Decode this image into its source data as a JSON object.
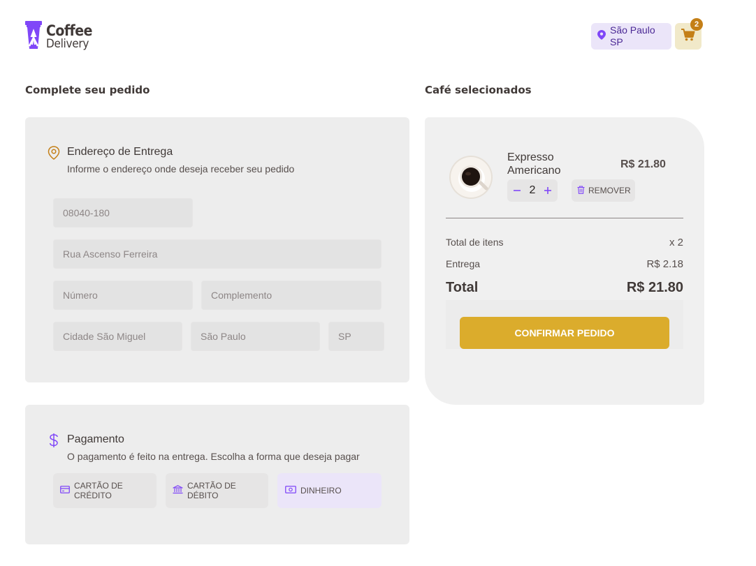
{
  "header": {
    "logo_line1": "Coffee",
    "logo_line2": "Delivery",
    "location_city": "São Paulo",
    "location_state": "SP",
    "cart_count": "2",
    "icons": {
      "logo": "cup-icon",
      "location": "map-pin-icon",
      "cart": "shopping-cart-icon"
    }
  },
  "checkout": {
    "title": "Complete seu pedido",
    "address": {
      "title": "Endereço de Entrega",
      "subtitle": "Informe o endereço onde deseja receber seu pedido",
      "cep": "08040-180",
      "street": "Rua Ascenso Ferreira",
      "number_placeholder": "Número",
      "complement_placeholder": "Complemento",
      "neighborhood": "Cidade São Miguel",
      "city": "São Paulo",
      "state": "SP"
    },
    "payment": {
      "title": "Pagamento",
      "subtitle": "O pagamento é feito na entrega. Escolha a forma que deseja pagar",
      "options": [
        {
          "label": "CARTÃO DE CRÉDITO",
          "icon": "credit-card-icon",
          "selected": false
        },
        {
          "label": "CARTÃO DE DÉBITO",
          "icon": "bank-icon",
          "selected": false
        },
        {
          "label": "DINHEIRO",
          "icon": "money-icon",
          "selected": true
        }
      ]
    }
  },
  "summary": {
    "title": "Café selecionados",
    "item": {
      "name": "Expresso Americano",
      "price": "R$ 21.80",
      "quantity": "2",
      "remove_label": "REMOVER"
    },
    "total_items_label": "Total de itens",
    "total_items_value": "x 2",
    "delivery_label": "Entrega",
    "delivery_value": "R$ 2.18",
    "total_label": "Total",
    "total_value": "R$ 21.80",
    "confirm_label": "CONFIRMAR PEDIDO"
  },
  "colors": {
    "purple": "#8047F8",
    "purple_dark": "#4B2995",
    "yellow": "#DBAC2C",
    "yellow_dark": "#C47F17",
    "card_bg": "#EDEDED"
  }
}
